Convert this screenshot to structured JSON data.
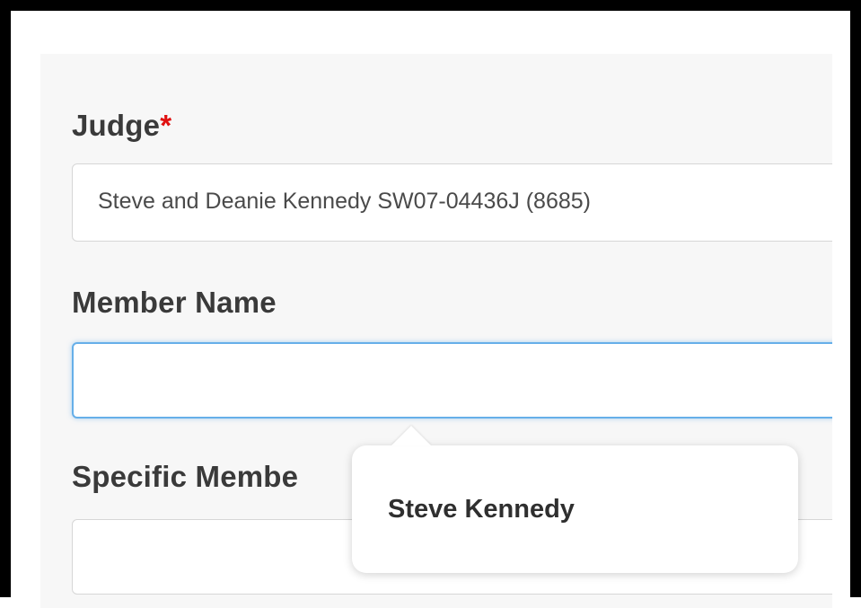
{
  "form": {
    "judge": {
      "label": "Judge",
      "required_marker": "*",
      "value": "Steve and Deanie Kennedy SW07-04436J (8685)"
    },
    "member_name": {
      "label": "Member Name",
      "value": "",
      "state": "focused"
    },
    "specific_member": {
      "label": "Specific Membe",
      "value": ""
    }
  },
  "suggestion_popup": {
    "items": [
      "Steve Kennedy"
    ]
  },
  "colors": {
    "required": "#e01010",
    "focus_border": "#66afe9",
    "panel_background": "#f7f7f7",
    "label_text": "#3a3a3a"
  }
}
